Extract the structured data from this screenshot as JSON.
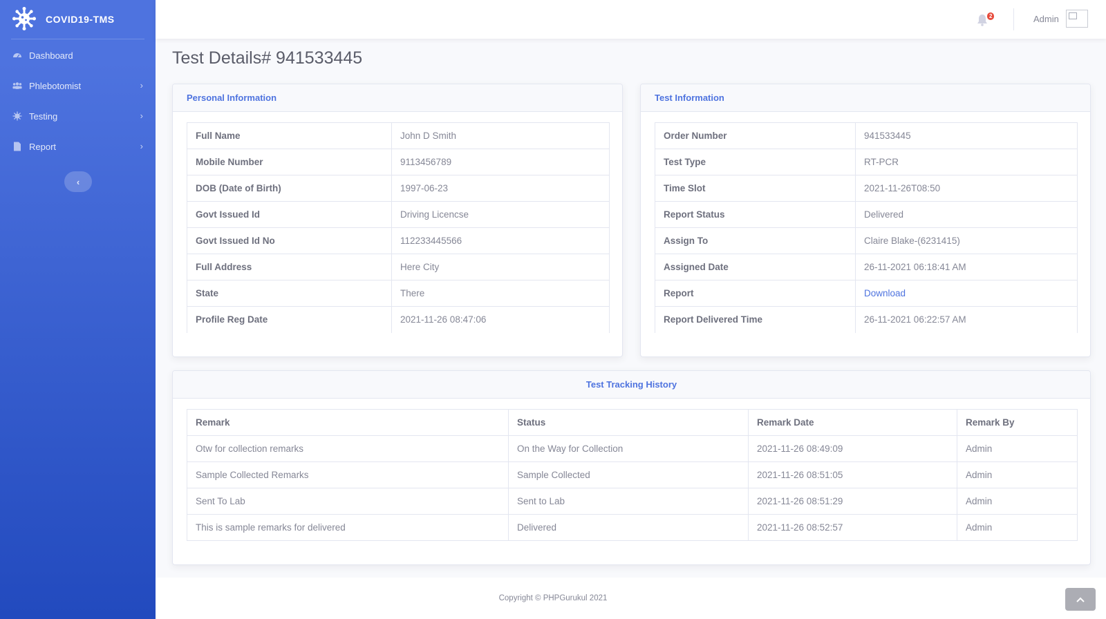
{
  "brand": {
    "title": "COVID19-TMS",
    "icon": "virus-icon"
  },
  "sidebar": {
    "items": [
      {
        "label": "Dashboard",
        "icon": "tachometer-icon",
        "has_children": false
      },
      {
        "label": "Phlebotomist",
        "icon": "users-icon",
        "has_children": true
      },
      {
        "label": "Testing",
        "icon": "virus-small-icon",
        "has_children": true
      },
      {
        "label": "Report",
        "icon": "file-icon",
        "has_children": true
      }
    ],
    "toggle_glyph": "‹"
  },
  "topbar": {
    "notification_count": "2",
    "username": "Admin"
  },
  "page": {
    "title": "Test Details# 941533445"
  },
  "personal": {
    "header": "Personal Information",
    "rows": [
      {
        "key": "Full Name",
        "value": "John D Smith"
      },
      {
        "key": "Mobile Number",
        "value": "9113456789"
      },
      {
        "key": "DOB (Date of Birth)",
        "value": "1997-06-23"
      },
      {
        "key": "Govt Issued Id",
        "value": "Driving Licencse"
      },
      {
        "key": "Govt Issued Id No",
        "value": "112233445566"
      },
      {
        "key": "Full Address",
        "value": "Here City"
      },
      {
        "key": "State",
        "value": "There"
      },
      {
        "key": "Profile Reg Date",
        "value": "2021-11-26 08:47:06"
      }
    ]
  },
  "test": {
    "header": "Test Information",
    "rows": [
      {
        "key": "Order Number",
        "value": "941533445"
      },
      {
        "key": "Test Type",
        "value": "RT-PCR"
      },
      {
        "key": "Time Slot",
        "value": "2021-11-26T08:50"
      },
      {
        "key": "Report Status",
        "value": "Delivered"
      },
      {
        "key": "Assign To",
        "value": "Claire Blake-(6231415)"
      },
      {
        "key": "Assigned Date",
        "value": "26-11-2021 06:18:41 AM"
      },
      {
        "key": "Report",
        "value": "Download"
      },
      {
        "key": "Report Delivered Time",
        "value": "26-11-2021 06:22:57 AM"
      }
    ]
  },
  "history": {
    "header": "Test Tracking History",
    "columns": [
      "Remark",
      "Status",
      "Remark Date",
      "Remark By"
    ],
    "rows": [
      [
        "Otw for collection remarks",
        "On the Way for Collection",
        "2021-11-26 08:49:09",
        "Admin"
      ],
      [
        "Sample Collected Remarks",
        "Sample Collected",
        "2021-11-26 08:51:05",
        "Admin"
      ],
      [
        "Sent To Lab",
        "Sent to Lab",
        "2021-11-26 08:51:29",
        "Admin"
      ],
      [
        "This is sample remarks for delivered",
        "Delivered",
        "2021-11-26 08:52:57",
        "Admin"
      ]
    ]
  },
  "footer": {
    "copyright": "Copyright © PHPGurukul 2021"
  },
  "colors": {
    "primary": "#4e73df",
    "sidebar_dark": "#224abe",
    "danger": "#e74a3b"
  }
}
